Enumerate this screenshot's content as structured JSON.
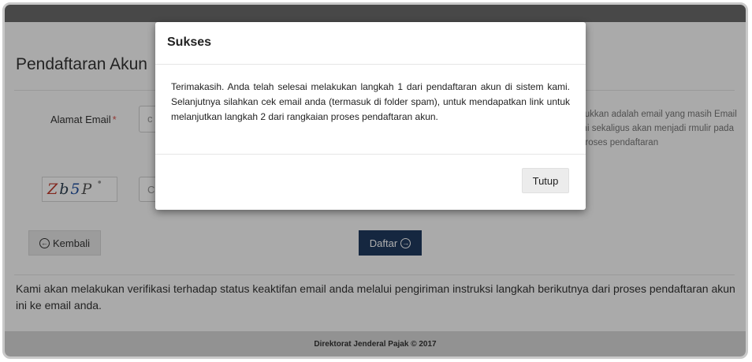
{
  "page": {
    "title": "Pendaftaran Akun",
    "email_label": "Alamat Email",
    "required_mark": "*",
    "email_placeholder": "c",
    "help_text": "sukkan adalah email yang masih Email ini sekaligus akan menjadi rmulir pada proses pendaftaran",
    "captcha": {
      "chars": [
        "Z",
        "b",
        "5",
        "P"
      ],
      "dot": "•"
    },
    "captcha_placeholder": "C",
    "back_label": "Kembali",
    "back_icon": "arrow-left-circle-icon",
    "submit_label": "Daftar",
    "submit_icon": "arrow-right-circle-icon",
    "info_text": "Kami akan melakukan verifikasi terhadap status keaktifan email anda melalui pengiriman instruksi langkah berikutnya dari proses pendaftaran akun ini ke email anda."
  },
  "footer": {
    "text": "Direktorat Jenderal Pajak © 2017"
  },
  "modal": {
    "title": "Sukses",
    "body": "Terimakasih. Anda telah selesai melakukan langkah 1 dari pendaftaran akun di sistem kami. Selanjutnya silahkan cek email anda (termasuk di folder spam), untuk mendapatkan link untuk melanjutkan langkah 2 dari rangkaian proses pendaftaran akun.",
    "close_label": "Tutup"
  },
  "colors": {
    "primary_button": "#1f3a5f",
    "required": "#d9534f",
    "overlay": "rgba(0,0,0,0.32)"
  }
}
